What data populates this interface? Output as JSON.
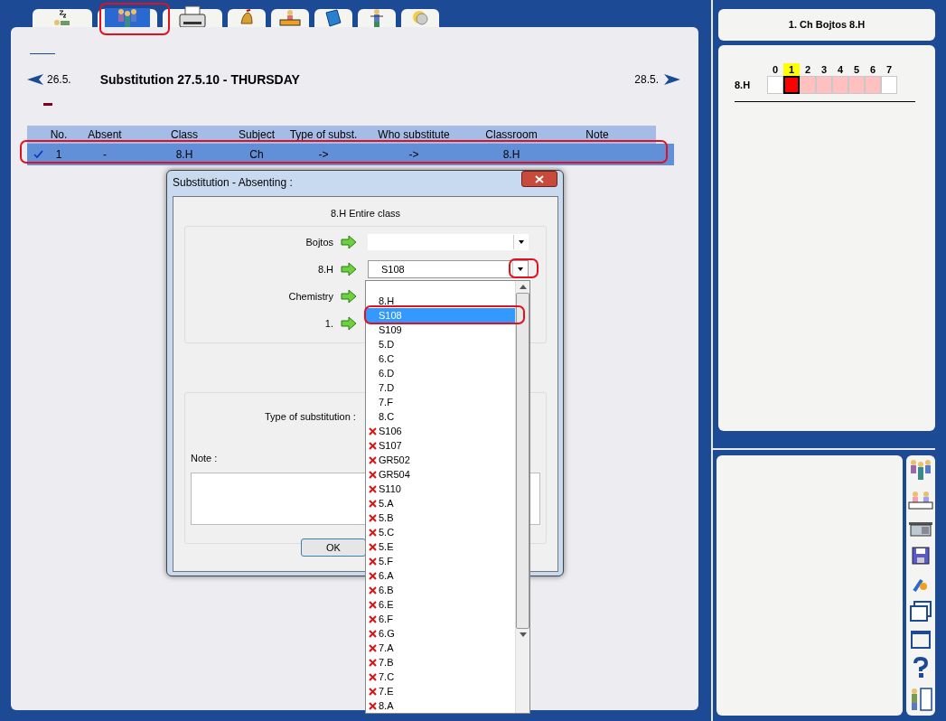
{
  "tabs": [
    {
      "kind": "sleep",
      "selected": false
    },
    {
      "kind": "people",
      "selected": true
    },
    {
      "kind": "printer",
      "selected": false
    },
    {
      "kind": "bell",
      "selected": false
    },
    {
      "kind": "desk",
      "selected": false
    },
    {
      "kind": "book",
      "selected": false
    },
    {
      "kind": "person",
      "selected": false
    },
    {
      "kind": "coin",
      "selected": false
    }
  ],
  "nav": {
    "prev": "26.5.",
    "title": "Substitution 27.5.10 - THURSDAY",
    "next": "28.5."
  },
  "table": {
    "columns": [
      "No.",
      "Absent",
      "Class",
      "Subject",
      "Type of subst.",
      "Who substitute",
      "Classroom",
      "Note"
    ],
    "rows": [
      {
        "checked": true,
        "selected": true,
        "cells": [
          "1",
          "-",
          "8.H",
          "Ch",
          "->",
          "->",
          "8.H",
          ""
        ]
      }
    ]
  },
  "dialog": {
    "title": "Substitution - Absenting :",
    "subtitle": "8.H Entire class",
    "fields": [
      {
        "label": "Bojtos"
      },
      {
        "label": "8.H",
        "value": "S108"
      },
      {
        "label": "Chemistry"
      },
      {
        "label": "1."
      }
    ],
    "type_label": "Type of substitution :",
    "note_label": "Note :",
    "ok": "OK"
  },
  "dropdown": [
    {
      "label": "8.H",
      "selected": false,
      "unavailable": false
    },
    {
      "label": "S108",
      "selected": true,
      "unavailable": false
    },
    {
      "label": "S109",
      "selected": false,
      "unavailable": false
    },
    {
      "label": "5.D",
      "selected": false,
      "unavailable": false
    },
    {
      "label": "6.C",
      "selected": false,
      "unavailable": false
    },
    {
      "label": "6.D",
      "selected": false,
      "unavailable": false
    },
    {
      "label": "7.D",
      "selected": false,
      "unavailable": false
    },
    {
      "label": "7.F",
      "selected": false,
      "unavailable": false
    },
    {
      "label": "8.C",
      "selected": false,
      "unavailable": false
    },
    {
      "label": "S106",
      "selected": false,
      "unavailable": true
    },
    {
      "label": "S107",
      "selected": false,
      "unavailable": true
    },
    {
      "label": "GR502",
      "selected": false,
      "unavailable": true
    },
    {
      "label": "GR504",
      "selected": false,
      "unavailable": true
    },
    {
      "label": "S110",
      "selected": false,
      "unavailable": true
    },
    {
      "label": "5.A",
      "selected": false,
      "unavailable": true
    },
    {
      "label": "5.B",
      "selected": false,
      "unavailable": true
    },
    {
      "label": "5.C",
      "selected": false,
      "unavailable": true
    },
    {
      "label": "5.E",
      "selected": false,
      "unavailable": true
    },
    {
      "label": "5.F",
      "selected": false,
      "unavailable": true
    },
    {
      "label": "6.A",
      "selected": false,
      "unavailable": true
    },
    {
      "label": "6.B",
      "selected": false,
      "unavailable": true
    },
    {
      "label": "6.E",
      "selected": false,
      "unavailable": true
    },
    {
      "label": "6.F",
      "selected": false,
      "unavailable": true
    },
    {
      "label": "6.G",
      "selected": false,
      "unavailable": true
    },
    {
      "label": "7.A",
      "selected": false,
      "unavailable": true
    },
    {
      "label": "7.B",
      "selected": false,
      "unavailable": true
    },
    {
      "label": "7.C",
      "selected": false,
      "unavailable": true
    },
    {
      "label": "7.E",
      "selected": false,
      "unavailable": true
    },
    {
      "label": "8.A",
      "selected": false,
      "unavailable": true
    }
  ],
  "side": {
    "title": "1. Ch Bojtos 8.H",
    "periods": [
      {
        "label": "0",
        "selected": false
      },
      {
        "label": "1",
        "selected": true
      },
      {
        "label": "2",
        "selected": false
      },
      {
        "label": "3",
        "selected": false
      },
      {
        "label": "4",
        "selected": false
      },
      {
        "label": "5",
        "selected": false
      },
      {
        "label": "6",
        "selected": false
      },
      {
        "label": "7",
        "selected": false
      }
    ],
    "row": {
      "label": "8.H",
      "cells": [
        {
          "kind": "free"
        },
        {
          "kind": "absent"
        },
        {
          "kind": "lesson"
        },
        {
          "kind": "lesson"
        },
        {
          "kind": "lesson"
        },
        {
          "kind": "lesson"
        },
        {
          "kind": "lesson"
        },
        {
          "kind": "free"
        }
      ]
    }
  },
  "toolbar": [
    {
      "kind": "people"
    },
    {
      "kind": "class"
    },
    {
      "kind": "desk"
    },
    {
      "kind": "save"
    },
    {
      "kind": "tools"
    },
    {
      "kind": "windows"
    },
    {
      "kind": "window"
    },
    {
      "kind": "help"
    },
    {
      "kind": "exit"
    }
  ]
}
